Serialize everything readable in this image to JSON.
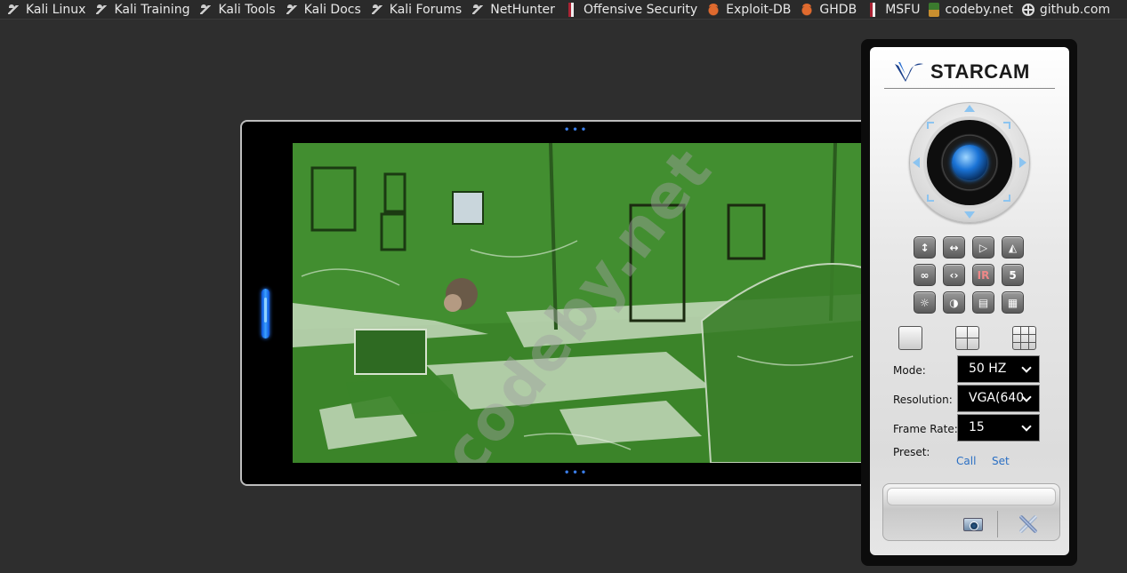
{
  "bookmarks": [
    {
      "label": "Kali Linux",
      "icon": "kali-dragon-icon"
    },
    {
      "label": "Kali Training",
      "icon": "kali-dragon-icon"
    },
    {
      "label": "Kali Tools",
      "icon": "kali-dragon-icon"
    },
    {
      "label": "Kali Docs",
      "icon": "kali-dragon-icon"
    },
    {
      "label": "Kali Forums",
      "icon": "kali-dragon-icon"
    },
    {
      "label": "NetHunter",
      "icon": "kali-dragon-icon"
    },
    {
      "label": "Offensive Security",
      "icon": "offsec-icon"
    },
    {
      "label": "Exploit-DB",
      "icon": "exploitdb-icon"
    },
    {
      "label": "GHDB",
      "icon": "exploitdb-icon"
    },
    {
      "label": "MSFU",
      "icon": "offsec-icon"
    },
    {
      "label": "codeby.net",
      "icon": "codeby-icon"
    },
    {
      "label": "github.com",
      "icon": "globe-icon"
    }
  ],
  "video": {
    "watermark": "codeby.net"
  },
  "panel": {
    "logo_text": "STARCAM",
    "function_buttons": [
      {
        "icon": "flip-vertical-icon",
        "glyph": "↕"
      },
      {
        "icon": "flip-horizontal-icon",
        "glyph": "↔"
      },
      {
        "icon": "play-icon",
        "glyph": "▷"
      },
      {
        "icon": "mirror-icon",
        "glyph": "◭"
      },
      {
        "icon": "patrol-h-icon",
        "glyph": "∞"
      },
      {
        "icon": "patrol-v-icon",
        "glyph": "‹›"
      },
      {
        "icon": "ir-icon",
        "glyph": "IR"
      },
      {
        "icon": "preset-number-icon",
        "glyph": "5"
      },
      {
        "icon": "brightness-icon",
        "glyph": "☼"
      },
      {
        "icon": "contrast-icon",
        "glyph": "◑"
      },
      {
        "icon": "image-settings-icon",
        "glyph": "▤"
      },
      {
        "icon": "color-settings-icon",
        "glyph": "▦"
      }
    ],
    "mode_label": "Mode:",
    "mode_value": "50 HZ",
    "resolution_label": "Resolution:",
    "resolution_value": "VGA(640",
    "framerate_label": "Frame Rate:",
    "framerate_value": "15",
    "preset_label": "Preset:",
    "preset_call": "Call",
    "preset_set": "Set"
  }
}
